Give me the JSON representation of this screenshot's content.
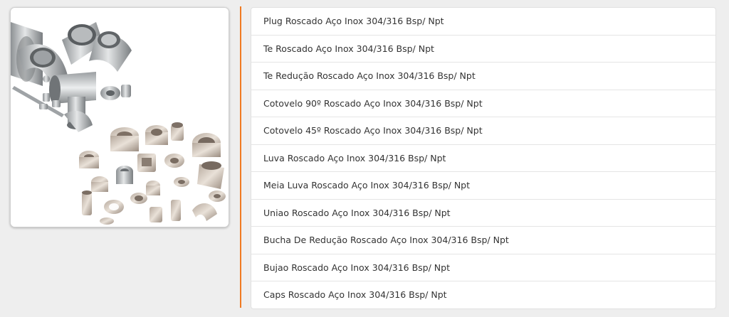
{
  "product_image": {
    "icon": "stainless-steel-threaded-fittings-photo"
  },
  "accent_color": "#f07a21",
  "links": [
    {
      "label": "Plug Roscado Aço Inox 304/316 Bsp/ Npt"
    },
    {
      "label": "Te Roscado Aço Inox 304/316 Bsp/ Npt"
    },
    {
      "label": "Te Redução Roscado Aço Inox 304/316 Bsp/ Npt"
    },
    {
      "label": "Cotovelo 90º Roscado Aço Inox 304/316 Bsp/ Npt"
    },
    {
      "label": "Cotovelo 45º Roscado Aço Inox 304/316 Bsp/ Npt"
    },
    {
      "label": "Luva Roscado Aço Inox 304/316 Bsp/ Npt"
    },
    {
      "label": "Meia Luva Roscado Aço Inox 304/316 Bsp/ Npt"
    },
    {
      "label": "Uniao Roscado Aço Inox 304/316 Bsp/ Npt"
    },
    {
      "label": "Bucha De Redução Roscado Aço Inox 304/316 Bsp/ Npt"
    },
    {
      "label": "Bujao Roscado Aço Inox 304/316 Bsp/ Npt"
    },
    {
      "label": "Caps Roscado Aço Inox 304/316 Bsp/ Npt"
    }
  ]
}
